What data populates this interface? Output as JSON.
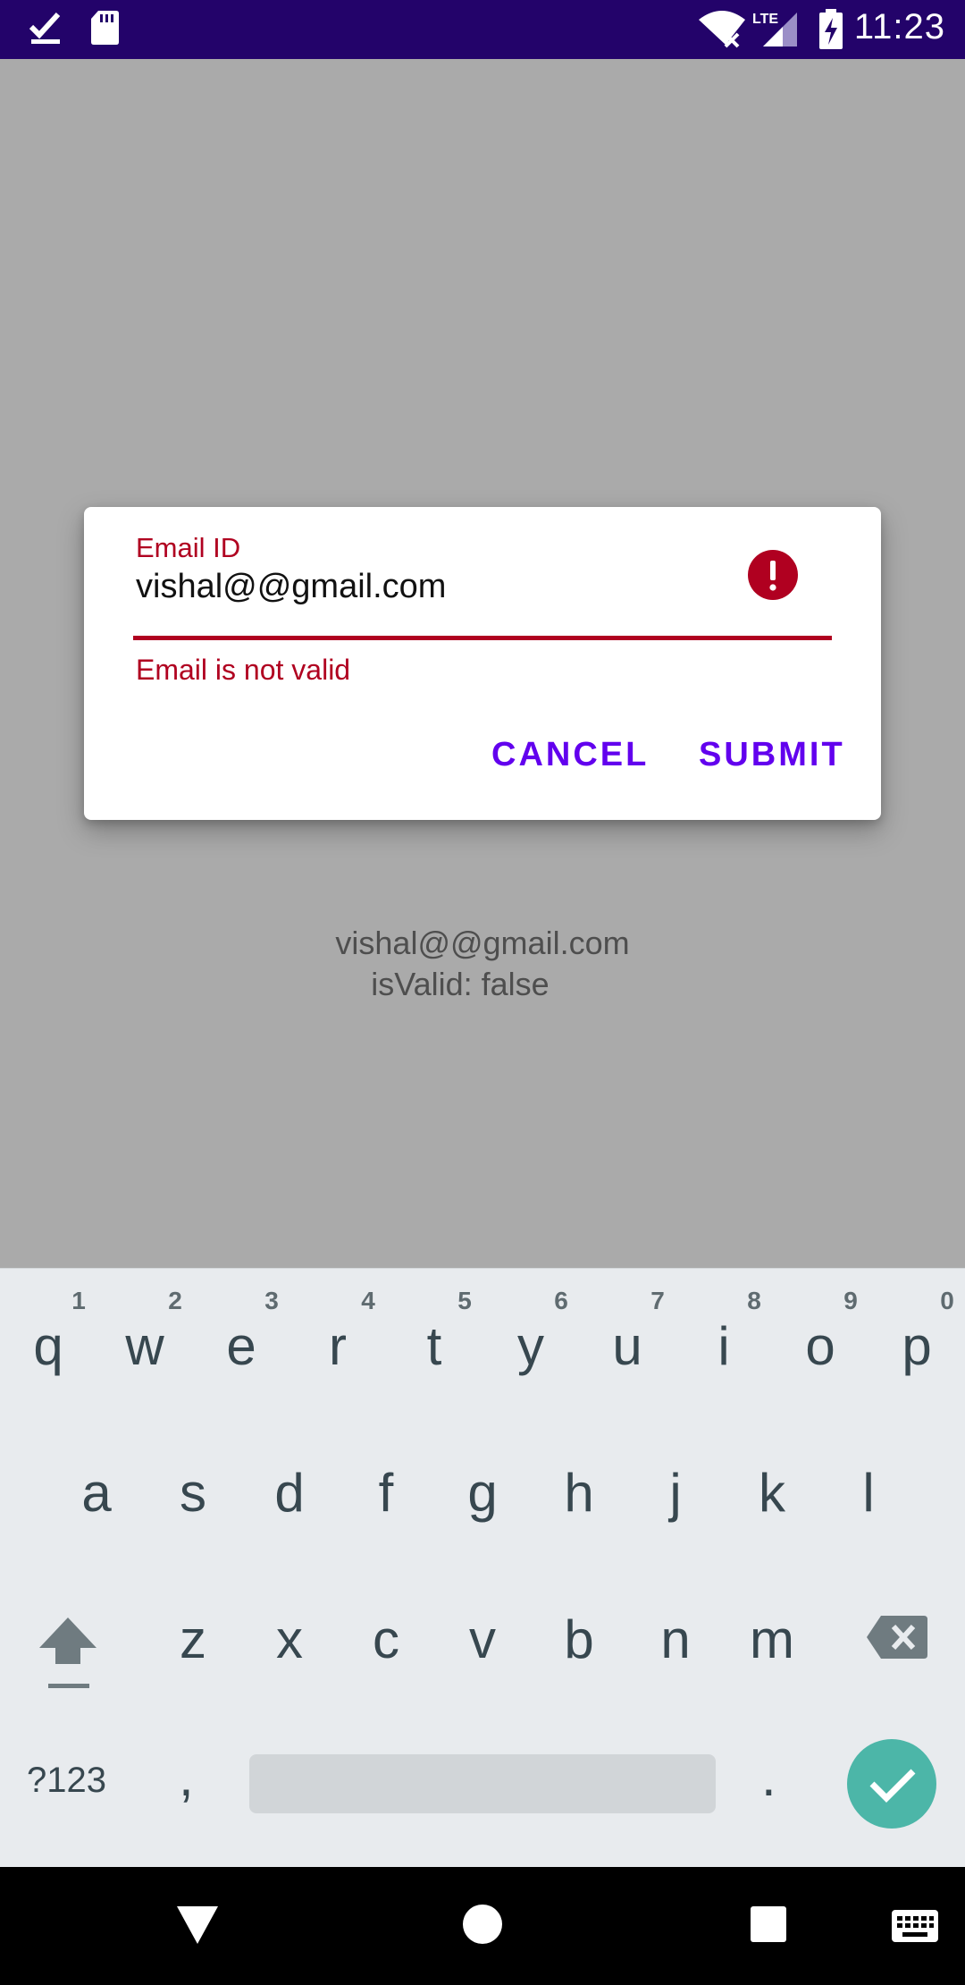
{
  "status_bar": {
    "time": "11:23",
    "icons": [
      "download-done-icon",
      "sd-card-icon",
      "wifi-off-icon",
      "lte-signal-icon",
      "battery-charging-icon"
    ],
    "network_label": "LTE",
    "background_color": "#23036a"
  },
  "dialog": {
    "field_label": "Email ID",
    "field_value": "vishal@@gmail.com",
    "error_message": "Email is not valid",
    "cancel_label": "CANCEL",
    "submit_label": "SUBMIT",
    "error_color": "#b00020",
    "accent_color": "#6200ee"
  },
  "result": {
    "line1": "vishal@@gmail.com",
    "line2": "isValid: false"
  },
  "keyboard": {
    "row1": [
      "q",
      "w",
      "e",
      "r",
      "t",
      "y",
      "u",
      "i",
      "o",
      "p"
    ],
    "row1_hints": [
      "1",
      "2",
      "3",
      "4",
      "5",
      "6",
      "7",
      "8",
      "9",
      "0"
    ],
    "row2": [
      "a",
      "s",
      "d",
      "f",
      "g",
      "h",
      "j",
      "k",
      "l"
    ],
    "row3": [
      "z",
      "x",
      "c",
      "v",
      "b",
      "n",
      "m"
    ],
    "symbols_label": "?123",
    "comma": ",",
    "period": ".",
    "enter_color": "#4cb6a8"
  },
  "nav_bar": {
    "buttons": [
      "back-icon",
      "home-icon",
      "recents-icon",
      "keyboard-switch-icon"
    ]
  }
}
